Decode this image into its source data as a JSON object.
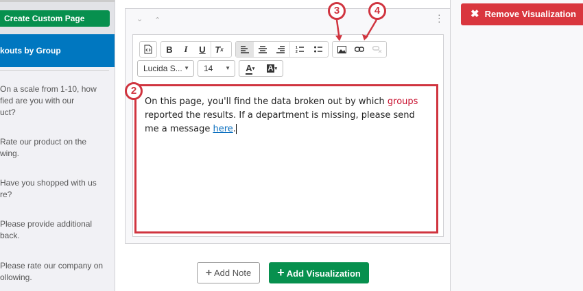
{
  "sidebar": {
    "create_button": "Create Custom Page",
    "active_page": "kouts by Group",
    "items": [
      {
        "line1": "On a scale from 1-10, how",
        "line2": "fied are you with our",
        "line3": "uct?"
      },
      {
        "line1": "Rate our product on the",
        "line2": "wing."
      },
      {
        "line1": "Have you shopped with us",
        "line2": "re?"
      },
      {
        "line1": "Please provide additional",
        "line2": "back."
      },
      {
        "line1": "Please rate our company on",
        "line2": "ollowing."
      }
    ]
  },
  "toolbar": {
    "font": "Lucida S...",
    "size": "14"
  },
  "editor": {
    "text1": "On this page, you'll find the data broken out by which ",
    "highlight": "groups",
    "text2": "reported the results. If a department is missing, please send me a message ",
    "link": "here",
    "text3": "."
  },
  "annotations": {
    "two": "2",
    "three": "3",
    "four": "4"
  },
  "actions": {
    "remove": "Remove Visualization",
    "add_note": "Add Note",
    "add_viz": "Add Visualization"
  },
  "colors": {
    "green": "#07904e",
    "blue": "#0077c0",
    "red": "#d9363e",
    "annotation": "#d0343f"
  }
}
